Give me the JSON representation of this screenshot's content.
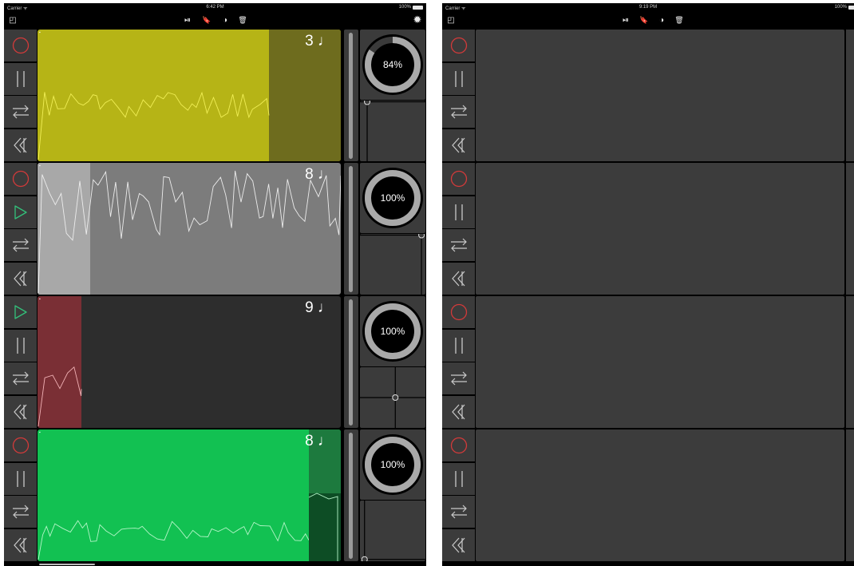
{
  "left_screen": {
    "status": {
      "carrier": "Carrier ᯤ",
      "time": "6:42 PM",
      "battery": "100%"
    },
    "toolbar": {
      "layout_icon": "◰",
      "play_skip_icon": "⏯",
      "bookmark_icon": "🔖",
      "contrast_icon": "◑",
      "trash_icon": "🗑",
      "settings_icon": "✹"
    },
    "tracks": [
      {
        "beats": "3 ♩",
        "state": "paused",
        "color": "#b6b416",
        "level_percent": 84,
        "level_label": "84%"
      },
      {
        "beats": "8 ♩",
        "state": "playing",
        "color": "#7c7c7c",
        "level_percent": 100,
        "level_label": "100%"
      },
      {
        "beats": "9 ♩",
        "state": "playing-first",
        "color": "#7a2f35",
        "level_percent": 100,
        "level_label": "100%"
      },
      {
        "beats": "8 ♩",
        "state": "paused",
        "color": "#12c152",
        "level_percent": 100,
        "level_label": "100%"
      }
    ]
  },
  "right_screen": {
    "status": {
      "carrier": "Carrier ᯤ",
      "time": "9:19 PM",
      "battery": "100%"
    },
    "toolbar": {
      "layout_icon": "◰",
      "play_skip_icon": "⏯",
      "bookmark_icon": "🔖",
      "contrast_icon": "◑",
      "trash_icon": "🗑"
    }
  },
  "controls": {
    "record_icon": "record-circle",
    "pause_icon": "pause-bars",
    "play_icon": "play-triangle",
    "loop_icon": "loop-arrows",
    "rewind_icon": "rewind-chevrons"
  },
  "colors": {
    "record": "#d23a3a",
    "play": "#33c07a",
    "icon": "#c9c9c9"
  }
}
